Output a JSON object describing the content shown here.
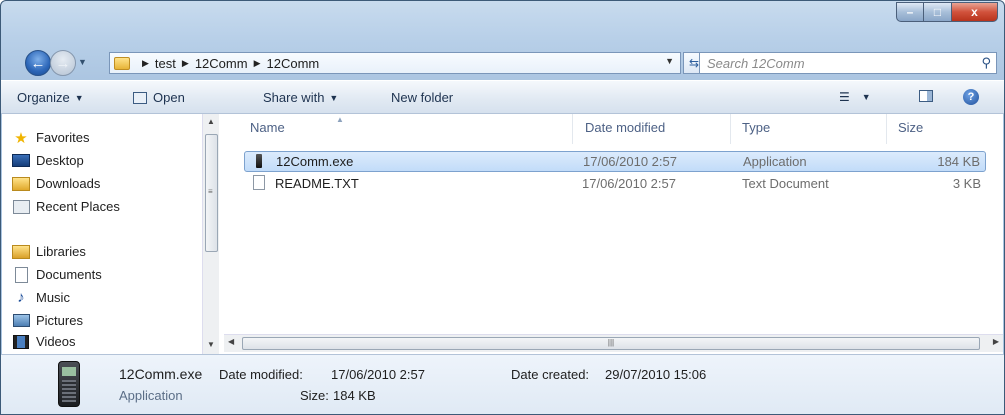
{
  "window": {
    "buttons": {
      "minimize": "–",
      "maximize": "□",
      "close": "x"
    }
  },
  "address_bar": {
    "breadcrumbs": [
      "test",
      "12Comm",
      "12Comm"
    ],
    "search_placeholder": "Search 12Comm"
  },
  "toolbar": {
    "organize": "Organize",
    "open": "Open",
    "share_with": "Share with",
    "new_folder": "New folder"
  },
  "nav": {
    "favorites": {
      "label": "Favorites",
      "items": [
        "Desktop",
        "Downloads",
        "Recent Places"
      ]
    },
    "libraries": {
      "label": "Libraries",
      "items": [
        "Documents",
        "Music",
        "Pictures",
        "Videos"
      ]
    }
  },
  "columns": {
    "name": "Name",
    "date": "Date modified",
    "type": "Type",
    "size": "Size"
  },
  "files": [
    {
      "name": "12Comm.exe",
      "date": "17/06/2010 2:57",
      "type": "Application",
      "size": "184 KB",
      "selected": true,
      "icon": "exe-icon"
    },
    {
      "name": "README.TXT",
      "date": "17/06/2010 2:57",
      "type": "Text Document",
      "size": "3 KB",
      "selected": false,
      "icon": "text-file-icon"
    }
  ],
  "details": {
    "name": "12Comm.exe",
    "type": "Application",
    "date_modified_label": "Date modified:",
    "date_modified": "17/06/2010 2:57",
    "size_label": "Size:",
    "size": "184 KB",
    "date_created_label": "Date created:",
    "date_created": "29/07/2010 15:06"
  },
  "colors": {
    "selection": "#c2dcf9",
    "selection_border": "#7da2ce",
    "chrome": "#b7cfe8"
  }
}
